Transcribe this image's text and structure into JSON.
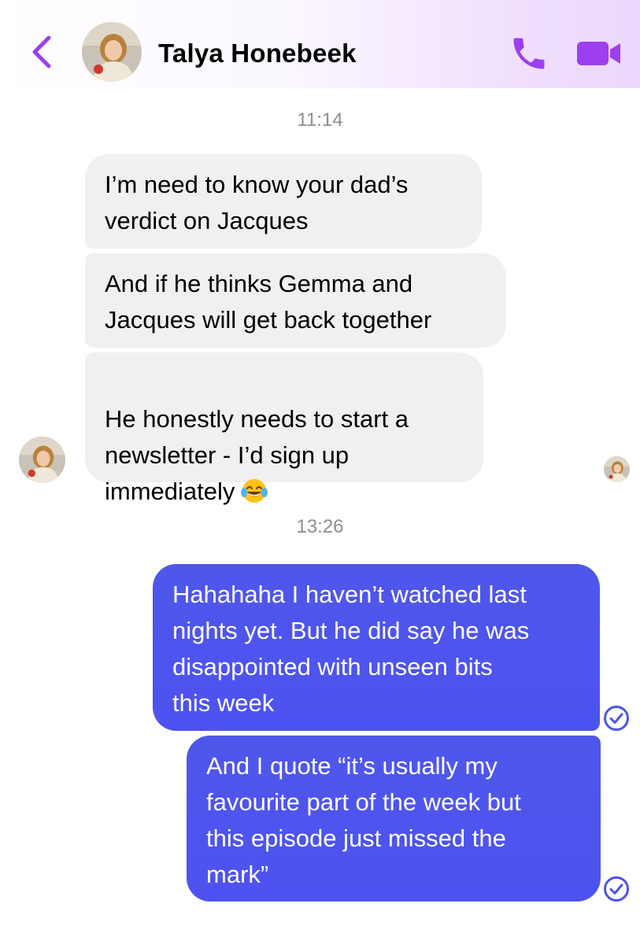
{
  "header": {
    "contact_name": "Talya Honebeek",
    "icons": {
      "back": "chevron-left-icon",
      "call": "phone-icon",
      "video": "video-camera-icon"
    },
    "accent_color": "#9d3ff0"
  },
  "conversation": {
    "timestamps": [
      "11:14",
      "13:26"
    ],
    "incoming": [
      "I’m need to know your dad’s\nverdict on Jacques",
      "And if he thinks Gemma and\nJacques will get back together",
      "He honestly needs to start a\nnewsletter - I’d sign up\nimmediately"
    ],
    "outgoing": [
      "Hahahaha I haven’t watched last\nnights yet. But he did say he was\ndisappointed with unseen bits\nthis week",
      "And I quote “it’s usually my\nfavourite part of the week but\nthis episode just missed the\nmark”"
    ],
    "emoji": "face-with-tears-of-joy",
    "incoming_bubble_color": "#f0f0f0",
    "outgoing_bubble_color": "#4e55ee",
    "receipt_color": "#4b55e8"
  }
}
